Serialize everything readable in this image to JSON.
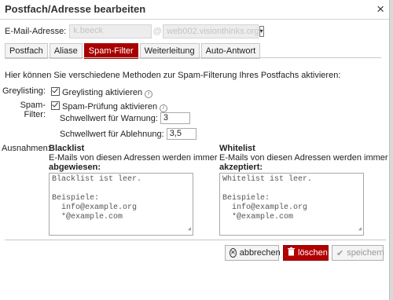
{
  "dialog": {
    "title": "Postfach/Adresse bearbeiten",
    "close_label": "×"
  },
  "email": {
    "label": "E-Mail-Adresse:",
    "local_value": "k.beeck",
    "at": "@",
    "domain_value": "web002.visionthinks.org",
    "domain_arrow": "▾"
  },
  "tabs": [
    {
      "label": "Postfach"
    },
    {
      "label": "Aliase"
    },
    {
      "label": "Spam-Filter"
    },
    {
      "label": "Weiterleitung"
    },
    {
      "label": "Auto-Antwort"
    }
  ],
  "active_tab": "Spam-Filter",
  "intro_text": "Hier können Sie verschiedene Methoden zur Spam-Filterung Ihres Postfachs aktivieren:",
  "greylisting": {
    "label": "Greylisting:",
    "checkbox_label": "Greylisting aktivieren",
    "checked": true,
    "info": "i"
  },
  "spamfilter": {
    "label": "Spam-Filter:",
    "checkbox_label": "Spam-Prüfung aktivieren",
    "checked": true,
    "info": "i"
  },
  "thresholds": {
    "warning_label": "Schwellwert für Warnung:",
    "warning_value": "3",
    "reject_label": "Schwellwert für Ablehnung:",
    "reject_value": "3,5"
  },
  "exceptions": {
    "label": "Ausnahmen:",
    "blacklist": {
      "title": "Blacklist",
      "desc_line1": "E-Mails von diesen Adressen werden immer",
      "desc_line2": "abgewiesen:",
      "placeholder": "Blacklist ist leer.\n\nBeispiele:\n  info@example.org\n  *@example.com"
    },
    "whitelist": {
      "title": "Whitelist",
      "desc_line1": "E-Mails von diesen Adressen werden immer",
      "desc_line2": "akzeptiert:",
      "placeholder": "Whitelist ist leer.\n\nBeispiele:\n  info@example.org\n  *@example.com"
    }
  },
  "buttons": {
    "cancel": "abbrechen",
    "delete": "löschen",
    "save": "speichern"
  },
  "colors": {
    "accent": "#a80000",
    "delete": "#b20000"
  }
}
